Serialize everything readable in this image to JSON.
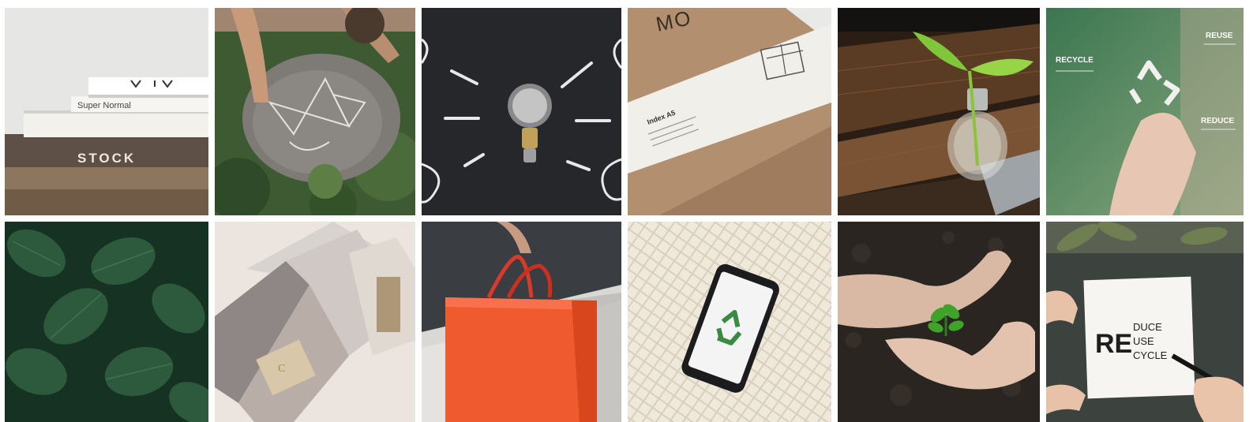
{
  "gallery": {
    "tiles": [
      {
        "subject": "books-stack",
        "texts": {
          "book_title": "Super Normal",
          "spine": "STOCK"
        }
      },
      {
        "subject": "child-chalk-drawing",
        "texts": {}
      },
      {
        "subject": "lightbulb-chalkboard",
        "texts": {}
      },
      {
        "subject": "kraft-notebook",
        "texts": {
          "brand": "MO",
          "label_title": "Index A5"
        }
      },
      {
        "subject": "plant-in-bulb",
        "texts": {}
      },
      {
        "subject": "recycle-touch",
        "texts": {
          "recycle": "RECYCLE",
          "reuse": "REUSE",
          "reduce": "REDUCE"
        }
      },
      {
        "subject": "green-leaves",
        "texts": {}
      },
      {
        "subject": "packaging-boxes",
        "texts": {}
      },
      {
        "subject": "red-shopping-bag",
        "texts": {}
      },
      {
        "subject": "phone-mesh-bag",
        "texts": {}
      },
      {
        "subject": "hands-seedling",
        "texts": {}
      },
      {
        "subject": "handwritten-note",
        "texts": {
          "re": "RE",
          "duce": "DUCE",
          "use": "USE",
          "cycle": "CYCLE"
        }
      }
    ],
    "colors": {
      "chalkboard": "#26272b",
      "kraft": "#b28f6e",
      "leaf_green": "#2d5a3c",
      "bag_red": "#ef5a2e",
      "soil": "#2a2521",
      "recycle_green": "#3a8a46"
    }
  }
}
